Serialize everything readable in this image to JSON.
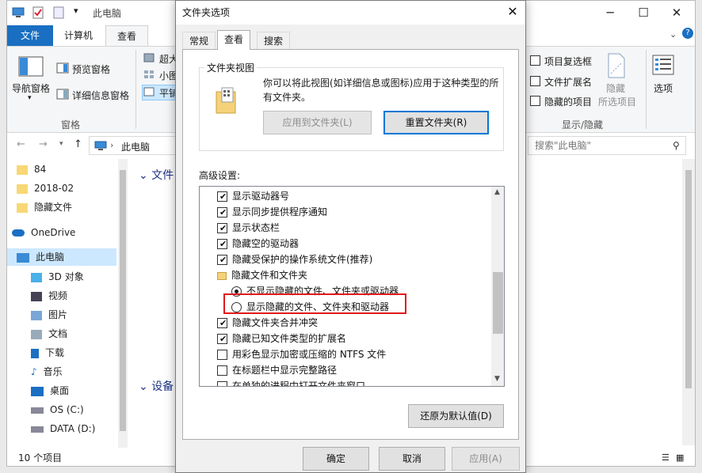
{
  "explorer": {
    "title": "此电脑",
    "tabs": {
      "file": "文件",
      "computer": "计算机",
      "view": "查看"
    },
    "ribbon": {
      "nav_pane": "导航窗格",
      "preview_pane": "预览窗格",
      "details_pane": "详细信息窗格",
      "pane_group": "窗格",
      "layout_1": "超大",
      "layout_2": "小图",
      "layout_3": "平铺",
      "item_checkboxes": "项目复选框",
      "file_extensions": "文件扩展名",
      "hidden_items": "隐藏的项目",
      "hide_selected": "隐藏",
      "hide_selected_2": "所选项目",
      "show_hide_group": "显示/隐藏",
      "options": "选项"
    },
    "address": "此电脑",
    "search_placeholder": "搜索\"此电脑\"",
    "nav": {
      "items": [
        "84",
        "2018-02",
        "隐藏文件",
        "OneDrive",
        "此电脑",
        "3D 对象",
        "视频",
        "图片",
        "文档",
        "下载",
        "音乐",
        "桌面",
        "OS (C:)",
        "DATA (D:)"
      ]
    },
    "sections": {
      "folders": "文件",
      "devices": "设备"
    },
    "status": "10 个项目"
  },
  "dialog": {
    "title": "文件夹选项",
    "tabs": [
      "常规",
      "查看",
      "搜索"
    ],
    "folder_views": {
      "title": "文件夹视图",
      "description": "你可以将此视图(如详细信息或图标)应用于这种类型的所有文件夹。",
      "apply_button": "应用到文件夹(L)",
      "reset_button": "重置文件夹(R)"
    },
    "advanced": {
      "title": "高级设置:",
      "items": [
        {
          "label": "显示驱动器号",
          "type": "check",
          "checked": true
        },
        {
          "label": "显示同步提供程序通知",
          "type": "check",
          "checked": true
        },
        {
          "label": "显示状态栏",
          "type": "check",
          "checked": true
        },
        {
          "label": "隐藏空的驱动器",
          "type": "check",
          "checked": true
        },
        {
          "label": "隐藏受保护的操作系统文件(推荐)",
          "type": "check",
          "checked": true
        },
        {
          "label": "隐藏文件和文件夹",
          "type": "folder"
        },
        {
          "label": "不显示隐藏的文件、文件夹或驱动器",
          "type": "radio",
          "checked": true
        },
        {
          "label": "显示隐藏的文件、文件夹和驱动器",
          "type": "radio",
          "checked": false
        },
        {
          "label": "隐藏文件夹合并冲突",
          "type": "check",
          "checked": true
        },
        {
          "label": "隐藏已知文件类型的扩展名",
          "type": "check",
          "checked": true
        },
        {
          "label": "用彩色显示加密或压缩的 NTFS 文件",
          "type": "check",
          "checked": false
        },
        {
          "label": "在标题栏中显示完整路径",
          "type": "check",
          "checked": false
        },
        {
          "label": "在单独的进程中打开文件夹窗口",
          "type": "check",
          "checked": false
        }
      ]
    },
    "restore_button": "还原为默认值(D)",
    "ok_button": "确定",
    "cancel_button": "取消",
    "apply_button": "应用(A)"
  },
  "colors": {
    "highlight": "#e0191b",
    "accent": "#1a6fc2",
    "focus": "#0078d7"
  }
}
